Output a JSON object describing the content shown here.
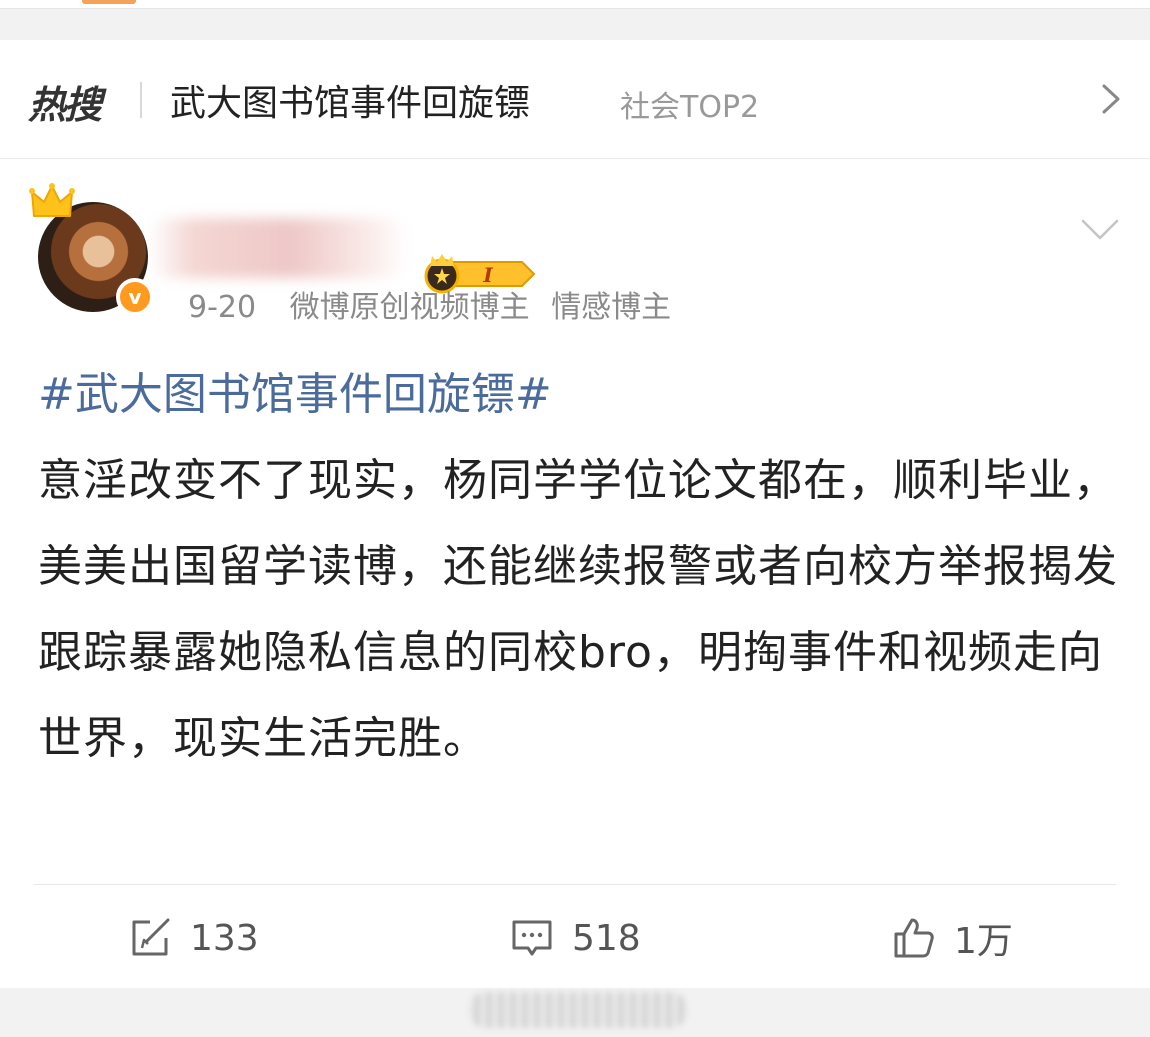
{
  "hot_search": {
    "logo_text": "热搜",
    "title": "武大图书馆事件回旋镖",
    "tag": "社会TOP2"
  },
  "post": {
    "user_level_badge": "I",
    "date": "9-20",
    "verification_1": "微博原创视频博主",
    "verification_2": "情感博主",
    "topic": "#武大图书馆事件回旋镖#",
    "text": "意淫改变不了现实，杨同学学位论文都在，顺利毕业，美美出国留学读博，还能继续报警或者向校方举报揭发跟踪暴露她隐私信息的同校bro，明掏事件和视频走向世界，现实生活完胜。",
    "verified_badge_glyph": "v"
  },
  "actions": {
    "repost_count": "133",
    "comment_count": "518",
    "like_count": "1万"
  },
  "icons": {
    "crown": "crown-icon",
    "chevron_right": "chevron-right-icon",
    "chevron_down": "chevron-down-icon",
    "repost": "repost-icon",
    "comment": "comment-icon",
    "like": "thumbs-up-icon"
  },
  "colors": {
    "accent_orange": "#ff8200",
    "topic_link": "#4a6b9b",
    "verify_badge": "#ff9a1f"
  }
}
